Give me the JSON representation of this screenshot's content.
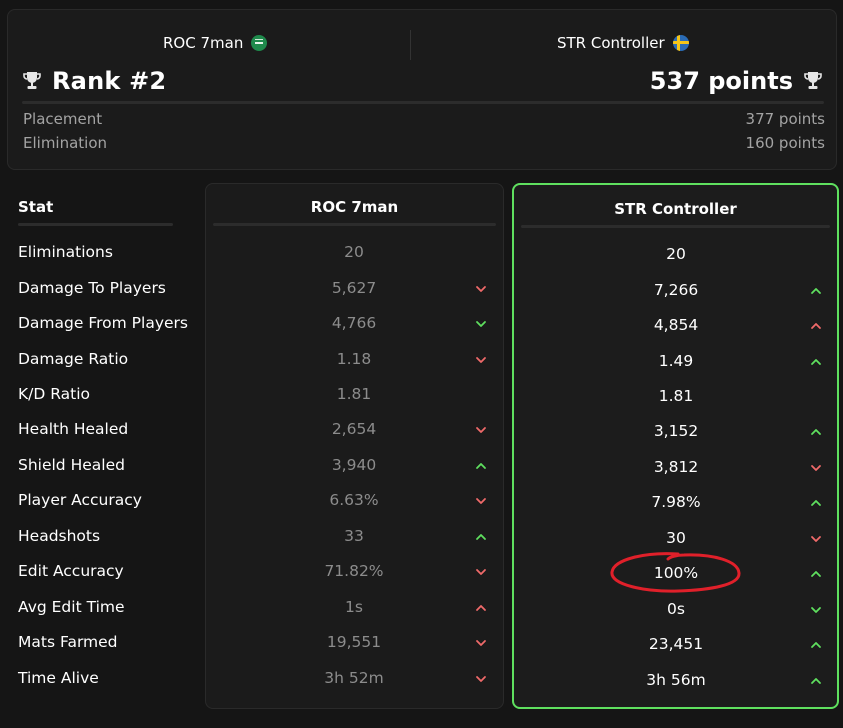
{
  "header": {
    "team_left": {
      "name": "ROC 7man",
      "flag": "saudi-flag-icon"
    },
    "team_right": {
      "name": "STR Controller",
      "flag": "sweden-flag-icon"
    },
    "rank": "Rank #2",
    "points": "537 points",
    "breakdown": [
      {
        "label": "Placement",
        "value": "377 points"
      },
      {
        "label": "Elimination",
        "value": "160 points"
      }
    ]
  },
  "table": {
    "stat_header": "Stat",
    "col_roc": "ROC 7man",
    "col_str": "STR Controller",
    "rows": [
      {
        "stat": "Eliminations",
        "roc": "20",
        "roc_trend": "none",
        "str": "20",
        "str_trend": "none"
      },
      {
        "stat": "Damage To Players",
        "roc": "5,627",
        "roc_trend": "down",
        "str": "7,266",
        "str_trend": "up"
      },
      {
        "stat": "Damage From Players",
        "roc": "4,766",
        "roc_trend": "down-good",
        "str": "4,854",
        "str_trend": "up-bad"
      },
      {
        "stat": "Damage Ratio",
        "roc": "1.18",
        "roc_trend": "down",
        "str": "1.49",
        "str_trend": "up"
      },
      {
        "stat": "K/D Ratio",
        "roc": "1.81",
        "roc_trend": "none",
        "str": "1.81",
        "str_trend": "none"
      },
      {
        "stat": "Health Healed",
        "roc": "2,654",
        "roc_trend": "down",
        "str": "3,152",
        "str_trend": "up"
      },
      {
        "stat": "Shield Healed",
        "roc": "3,940",
        "roc_trend": "up",
        "str": "3,812",
        "str_trend": "down"
      },
      {
        "stat": "Player Accuracy",
        "roc": "6.63%",
        "roc_trend": "down",
        "str": "7.98%",
        "str_trend": "up"
      },
      {
        "stat": "Headshots",
        "roc": "33",
        "roc_trend": "up",
        "str": "30",
        "str_trend": "down"
      },
      {
        "stat": "Edit Accuracy",
        "roc": "71.82%",
        "roc_trend": "down",
        "str": "100%",
        "str_trend": "up"
      },
      {
        "stat": "Avg Edit Time",
        "roc": "1s",
        "roc_trend": "up-bad",
        "str": "0s",
        "str_trend": "down-good"
      },
      {
        "stat": "Mats Farmed",
        "roc": "19,551",
        "roc_trend": "down",
        "str": "23,451",
        "str_trend": "up"
      },
      {
        "stat": "Time Alive",
        "roc": "3h 52m",
        "roc_trend": "down",
        "str": "3h 56m",
        "str_trend": "up"
      }
    ]
  },
  "colors": {
    "good": "#5fe05f",
    "bad": "#f06a6a",
    "highlight_border": "#5fe05f",
    "annotation": "#e0202a"
  }
}
